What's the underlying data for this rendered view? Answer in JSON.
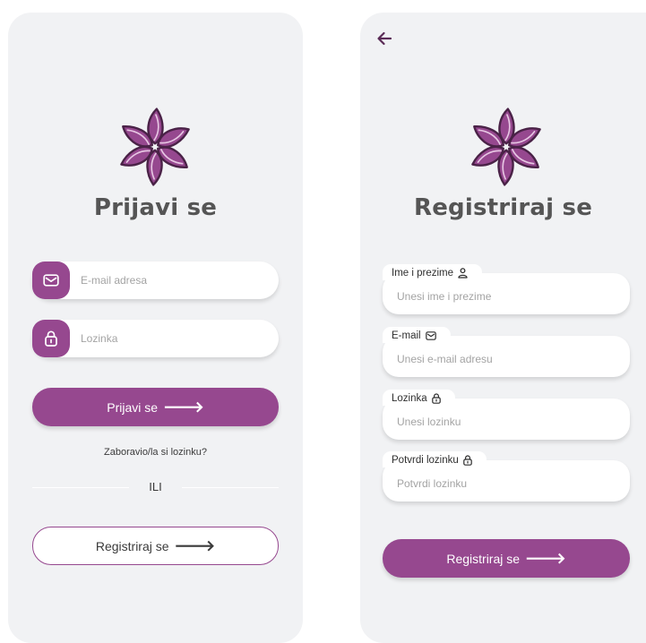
{
  "colors": {
    "accent": "#96488f",
    "panel_bg": "#f1f2f4",
    "title": "#555555"
  },
  "login": {
    "title": "Prijavi se",
    "email": {
      "placeholder": "E-mail adresa",
      "icon": "mail-icon"
    },
    "password": {
      "placeholder": "Lozinka",
      "icon": "lock-icon"
    },
    "submit_label": "Prijavi se",
    "forgot_label": "Zaboravio/la si lozinku?",
    "or_label": "ILI",
    "register_label": "Registriraj se"
  },
  "register": {
    "back_icon": "arrow-left-icon",
    "title": "Registriraj se",
    "fields": [
      {
        "label": "Ime i prezime",
        "placeholder": "Unesi ime i prezime",
        "icon": "user-icon"
      },
      {
        "label": "E-mail",
        "placeholder": "Unesi e-mail adresu",
        "icon": "mail-icon"
      },
      {
        "label": "Lozinka",
        "placeholder": "Unesi lozinku",
        "icon": "lock-icon"
      },
      {
        "label": "Potvrdi lozinku",
        "placeholder": "Potvrdi lozinku",
        "icon": "lock-icon"
      }
    ],
    "submit_label": "Registriraj se"
  }
}
